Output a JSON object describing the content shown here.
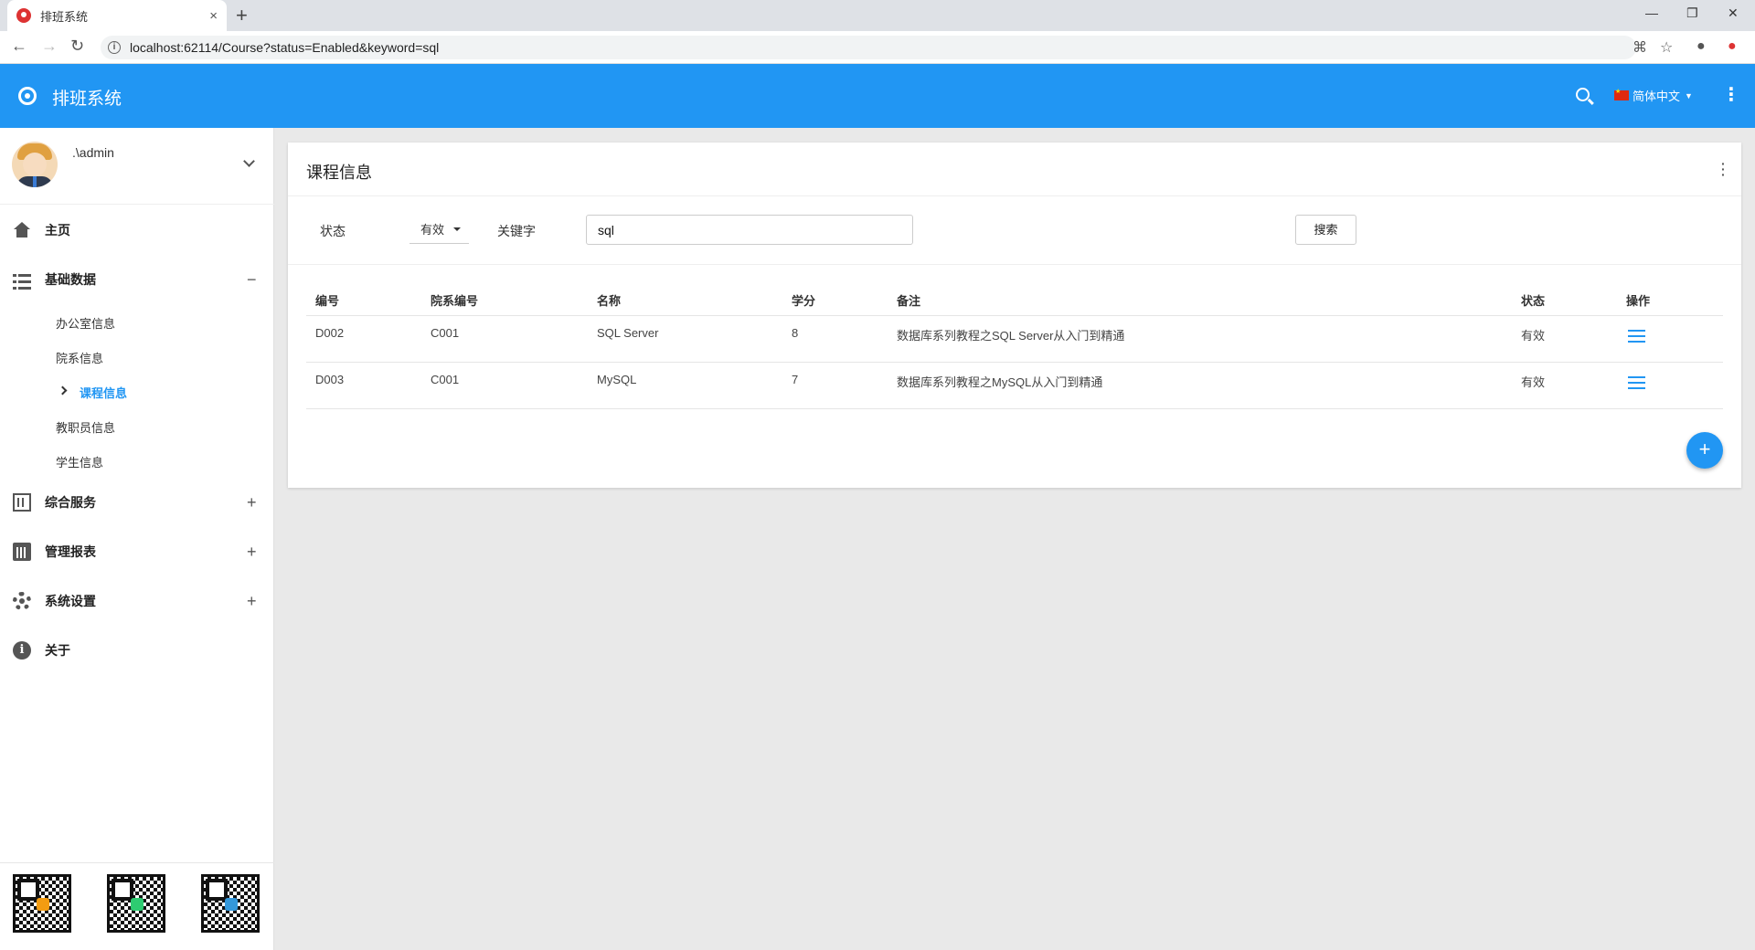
{
  "browser": {
    "tab_title": "排班系统",
    "tab_close": "×",
    "new_tab": "+",
    "url": "localhost:62114/Course?status=Enabled&keyword=sql",
    "window_controls": [
      "—",
      "❐",
      "✕"
    ]
  },
  "app": {
    "title": "排班系统",
    "language": "简体中文",
    "accent_color": "#2196f3"
  },
  "user": {
    "name": ".\\admin"
  },
  "sidebar": {
    "items": [
      {
        "label": "主页",
        "icon": "home-icon"
      },
      {
        "label": "基础数据",
        "icon": "list-icon",
        "toggle": "−"
      },
      {
        "label": "综合服务",
        "icon": "building-icon",
        "toggle": "+"
      },
      {
        "label": "管理报表",
        "icon": "chart-icon",
        "toggle": "+"
      },
      {
        "label": "系统设置",
        "icon": "gear-icon",
        "toggle": "+"
      },
      {
        "label": "关于",
        "icon": "info-icon"
      }
    ],
    "subitems": [
      {
        "label": "办公室信息"
      },
      {
        "label": "院系信息"
      },
      {
        "label": "课程信息",
        "active": true
      },
      {
        "label": "教职员信息"
      },
      {
        "label": "学生信息"
      }
    ]
  },
  "main": {
    "title": "课程信息",
    "filter": {
      "status_label": "状态",
      "status_value": "有效",
      "keyword_label": "关键字",
      "keyword_value": "sql",
      "search_button": "搜索"
    },
    "table": {
      "headers": [
        "编号",
        "院系编号",
        "名称",
        "学分",
        "备注",
        "状态",
        "操作"
      ],
      "rows": [
        {
          "id": "D002",
          "dept": "C001",
          "name": "SQL Server",
          "credit": "8",
          "remark": "数据库系列教程之SQL Server从入门到精通",
          "status": "有效"
        },
        {
          "id": "D003",
          "dept": "C001",
          "name": "MySQL",
          "credit": "7",
          "remark": "数据库系列教程之MySQL从入门到精通",
          "status": "有效"
        }
      ]
    },
    "add_button": "+"
  }
}
